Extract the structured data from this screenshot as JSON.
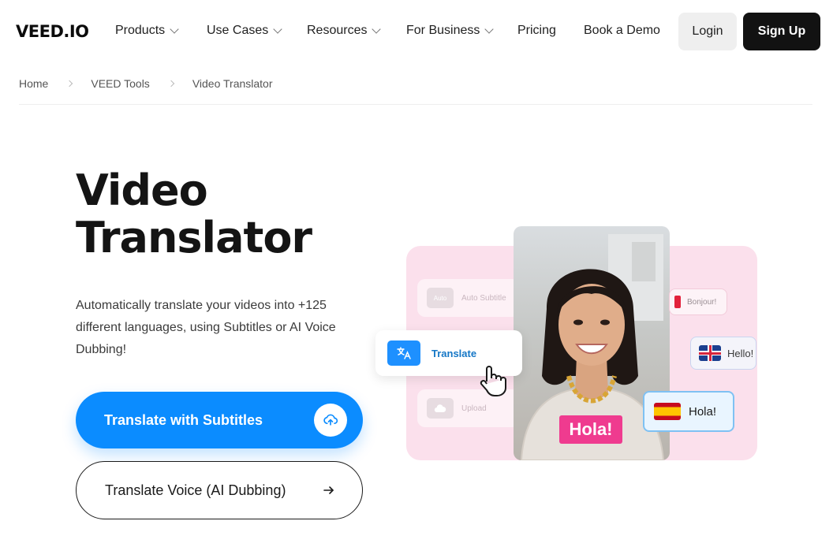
{
  "nav": {
    "logo": "VEED.IO",
    "items": [
      {
        "label": "Products",
        "has_dropdown": true
      },
      {
        "label": "Use Cases",
        "has_dropdown": true
      },
      {
        "label": "Resources",
        "has_dropdown": true
      },
      {
        "label": "For Business",
        "has_dropdown": true
      },
      {
        "label": "Pricing",
        "has_dropdown": false
      },
      {
        "label": "Book a Demo",
        "has_dropdown": false
      }
    ],
    "login": "Login",
    "signup": "Sign Up"
  },
  "breadcrumb": [
    "Home",
    "VEED Tools",
    "Video Translator"
  ],
  "hero": {
    "title_line1": "Video",
    "title_line2": "Translator",
    "description": "Automatically translate your videos into +125 different languages, using Subtitles or AI Voice Dubbing!",
    "primary_button": "Translate with Subtitles",
    "secondary_button": "Translate Voice (AI Dubbing)"
  },
  "illustration": {
    "ghost_cards": [
      {
        "icon_text": "Auto",
        "label": "Auto Subtitle"
      },
      {
        "icon_text": "",
        "label": "Upload"
      }
    ],
    "translate_card": {
      "icon": "translate-icon",
      "label": "Translate"
    },
    "bubbles": {
      "bonjour": "Bonjour!",
      "hello": "Hello!",
      "hola": "Hola!",
      "hola_caption": "Hola!"
    }
  },
  "colors": {
    "brand_blue": "#0b8cff",
    "dark": "#121212",
    "pink": "#ef3b8f",
    "illustration_bg": "#fbe0ec"
  }
}
